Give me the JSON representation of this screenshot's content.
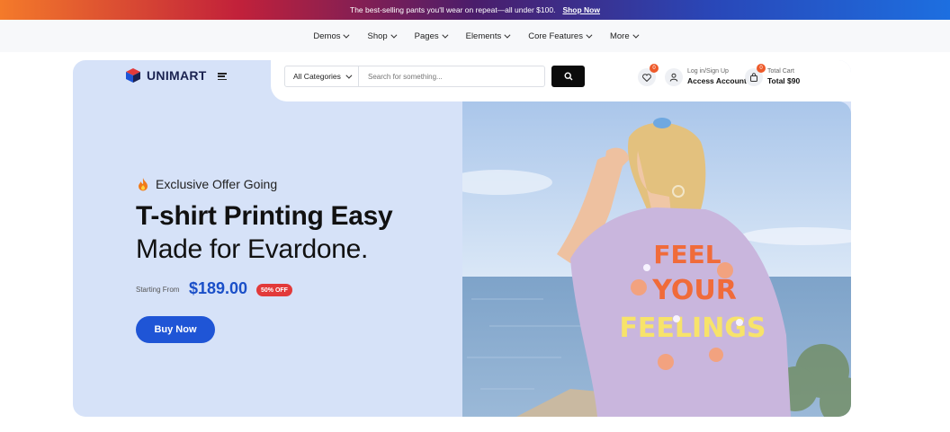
{
  "promo": {
    "text": "The best-selling pants you'll wear on repeat—all under $100.",
    "link": "Shop Now"
  },
  "nav": {
    "items": [
      {
        "label": "Demos"
      },
      {
        "label": "Shop"
      },
      {
        "label": "Pages"
      },
      {
        "label": "Elements"
      },
      {
        "label": "Core Features"
      },
      {
        "label": "More"
      }
    ]
  },
  "header": {
    "logo": "UNIMART",
    "search": {
      "category": "All Categories",
      "placeholder": "Search for something..."
    },
    "wishlist_count": "0",
    "account": {
      "top": "Log in/Sign Up",
      "bottom": "Access Account"
    },
    "cart": {
      "count": "0",
      "top": "Total Cart",
      "bottom": "Total $90"
    }
  },
  "hero": {
    "eyebrow": "Exclusive Offer Going",
    "title_line1": "T-shirt Printing Easy",
    "title_line2": "Made for Evardone.",
    "starting_label": "Starting From",
    "price": "$189.00",
    "discount": "50% OFF",
    "cta": "Buy Now",
    "shirt_text": [
      "FEEL",
      "YOUR",
      "FEELINGS"
    ]
  },
  "colors": {
    "accent": "#1f55d6",
    "badge": "#ee5a2a",
    "hero_bg": "#d6e2f8",
    "discount": "#e23a3a"
  }
}
